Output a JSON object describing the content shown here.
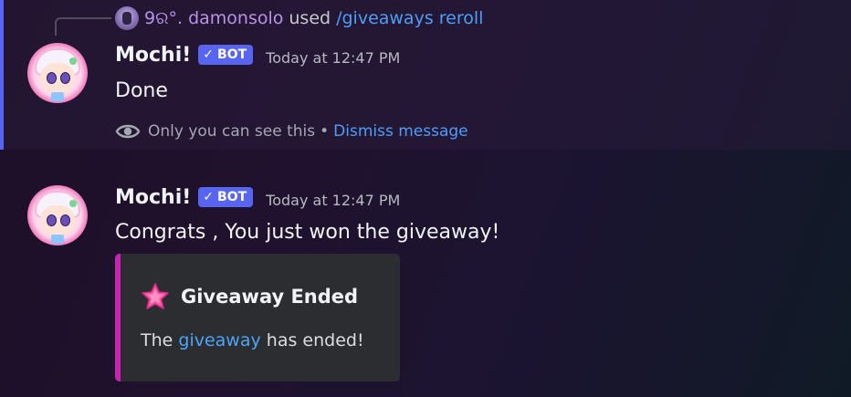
{
  "colors": {
    "ephemeral_bar": "#5865f2",
    "bot_tag": "#5865f2",
    "link": "#4e9ef7",
    "reply_name": "#b793e6",
    "embed_accent": "#c724b1",
    "embed_bg": "#2b2d31"
  },
  "reply": {
    "username": "9ର°. damonsolo",
    "used_text": "used",
    "command": "/giveaways reroll"
  },
  "messages": [
    {
      "author": "Mochi!",
      "bot_tag": "BOT",
      "timestamp": "Today at 12:47 PM",
      "content": "Done",
      "ephemeral_note": "Only you can see this",
      "separator": "•",
      "dismiss_label": "Dismiss message"
    },
    {
      "author": "Mochi!",
      "bot_tag": "BOT",
      "timestamp": "Today at 12:47 PM",
      "content": "Congrats , You just won the giveaway!",
      "embed": {
        "icon": "pink-star-icon",
        "title": "Giveaway Ended",
        "desc_prefix": "The",
        "desc_link": "giveaway",
        "desc_suffix": "has ended!"
      }
    }
  ]
}
